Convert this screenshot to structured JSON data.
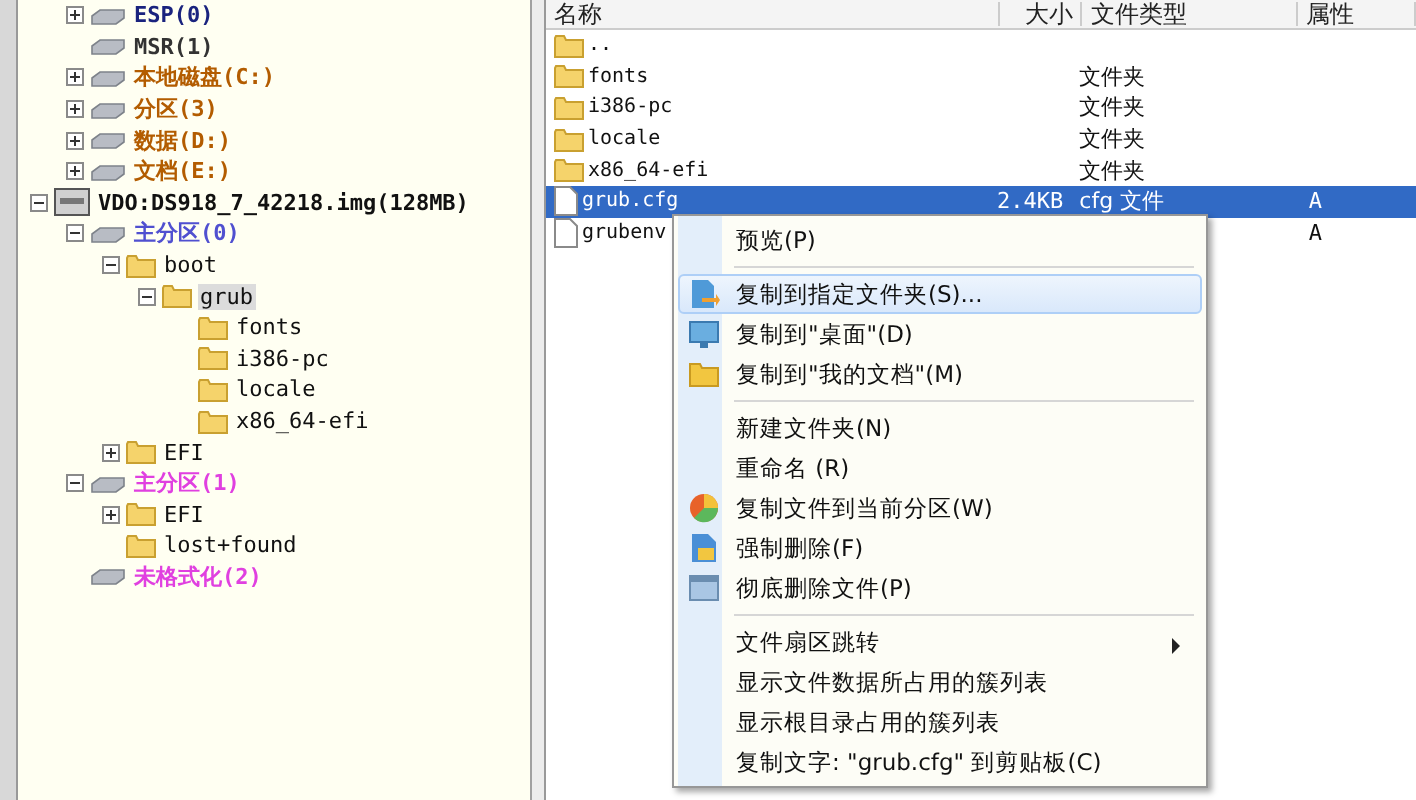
{
  "tree": {
    "continued_children": [
      {
        "label": "ESP(0)",
        "kind": "partition",
        "color": "#1a237e",
        "expanded": false
      },
      {
        "label": "MSR(1)",
        "kind": "partition",
        "color": "#333333"
      },
      {
        "label": "本地磁盘(C:)",
        "kind": "partition",
        "color": "#b35c00",
        "expanded": false
      },
      {
        "label": "分区(3)",
        "kind": "partition",
        "color": "#b35c00",
        "expanded": false
      },
      {
        "label": "数据(D:)",
        "kind": "partition",
        "color": "#b35c00",
        "expanded": false
      },
      {
        "label": "文档(E:)",
        "kind": "partition",
        "color": "#b35c00",
        "expanded": false
      }
    ],
    "items": [
      {
        "label": "VDO:DS918_7_42218.img(128MB)",
        "kind": "disk",
        "color": "#111111",
        "expanded": true,
        "children": [
          {
            "label": "主分区(0)",
            "kind": "partition",
            "color": "#5050d0",
            "expanded": true,
            "children": [
              {
                "label": "boot",
                "kind": "folder",
                "expanded": true,
                "children": [
                  {
                    "label": "grub",
                    "kind": "folder",
                    "expanded": true,
                    "selected": true,
                    "children": [
                      {
                        "label": "fonts",
                        "kind": "folder",
                        "selected": false
                      },
                      {
                        "label": "i386-pc",
                        "kind": "folder",
                        "selected": false
                      },
                      {
                        "label": "locale",
                        "kind": "folder",
                        "selected": false
                      },
                      {
                        "label": "x86_64-efi",
                        "kind": "folder",
                        "selected": false
                      }
                    ]
                  }
                ],
                "selected": false
              },
              {
                "label": "EFI",
                "kind": "folder",
                "expanded": false,
                "selected": false
              }
            ]
          },
          {
            "label": "主分区(1)",
            "kind": "partition",
            "color": "#e040e0",
            "expanded": true,
            "children": [
              {
                "label": "EFI",
                "kind": "folder",
                "expanded": false,
                "selected": false
              },
              {
                "label": "lost+found",
                "kind": "folder",
                "selected": false
              }
            ]
          },
          {
            "label": "未格式化(2)",
            "kind": "partition",
            "color": "#e040e0"
          }
        ]
      }
    ]
  },
  "file_list": {
    "columns": [
      "名称",
      "大小",
      "文件类型",
      "属性"
    ],
    "rows": [
      {
        "kind": "folder",
        "name": "..",
        "selected": false
      },
      {
        "kind": "folder",
        "name": "fonts",
        "type": "文件夹",
        "selected": false
      },
      {
        "kind": "folder",
        "name": "i386-pc",
        "type": "文件夹",
        "selected": false
      },
      {
        "kind": "folder",
        "name": "locale",
        "type": "文件夹",
        "selected": false
      },
      {
        "kind": "folder",
        "name": "x86_64-efi",
        "type": "文件夹",
        "selected": false
      },
      {
        "kind": "file",
        "name": "grub.cfg",
        "size": "2.4KB",
        "type": "cfg 文件",
        "attr": "A",
        "selected": true
      },
      {
        "kind": "file",
        "name": "grubenv",
        "attr": "A",
        "selected": false
      }
    ]
  },
  "context_menu": [
    {
      "kind": "item",
      "label": "预览(P)",
      "highlighted": false
    },
    {
      "kind": "separator"
    },
    {
      "kind": "item",
      "label": "复制到指定文件夹(S)...",
      "highlighted": true
    },
    {
      "kind": "item",
      "label": "复制到\"桌面\"(D)",
      "highlighted": false
    },
    {
      "kind": "item",
      "label": "复制到\"我的文档\"(M)",
      "highlighted": false
    },
    {
      "kind": "separator"
    },
    {
      "kind": "item",
      "label": "新建文件夹(N)",
      "highlighted": false
    },
    {
      "kind": "item",
      "label": "重命名 (R)",
      "highlighted": false
    },
    {
      "kind": "item",
      "label": "复制文件到当前分区(W)",
      "highlighted": false
    },
    {
      "kind": "item",
      "label": "强制删除(F)",
      "highlighted": false
    },
    {
      "kind": "item",
      "label": "彻底删除文件(P)",
      "highlighted": false
    },
    {
      "kind": "separator"
    },
    {
      "kind": "item",
      "label": "文件扇区跳转",
      "submenu": true,
      "highlighted": false
    },
    {
      "kind": "item",
      "label": "显示文件数据所占用的簇列表",
      "highlighted": false
    },
    {
      "kind": "item",
      "label": "显示根目录占用的簇列表",
      "highlighted": false
    },
    {
      "kind": "item",
      "label": "复制文字: \"grub.cfg\" 到剪贴板(C)",
      "highlighted": false
    }
  ]
}
